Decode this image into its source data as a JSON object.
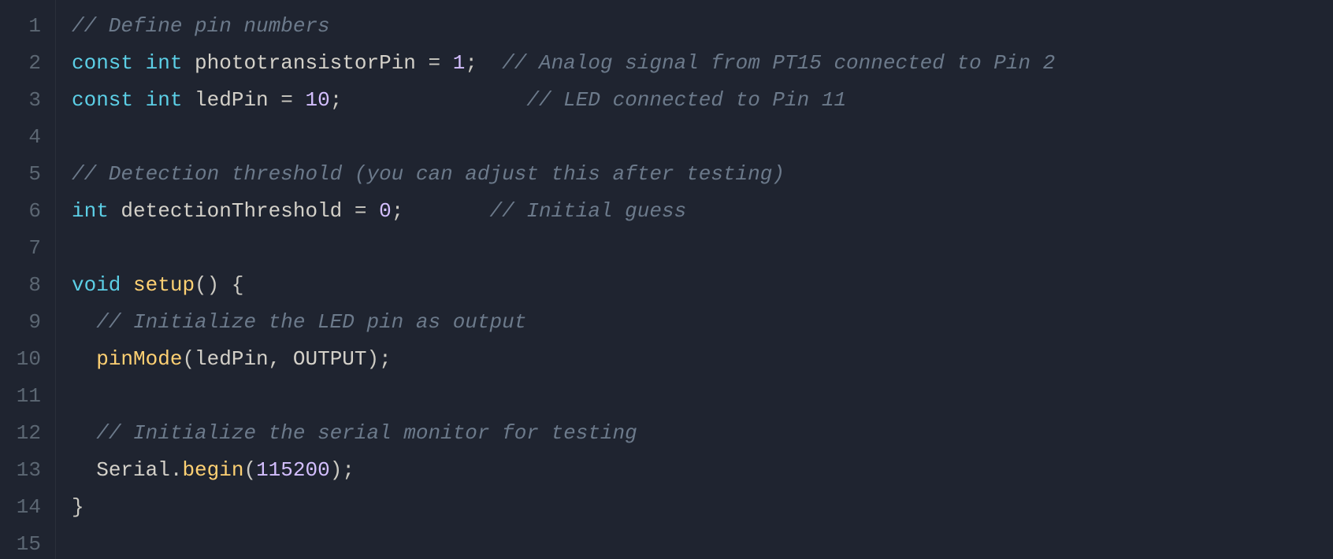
{
  "editor": {
    "lineNumbers": [
      "1",
      "2",
      "3",
      "4",
      "5",
      "6",
      "7",
      "8",
      "9",
      "10",
      "11",
      "12",
      "13",
      "14",
      "15"
    ],
    "code": {
      "l1": {
        "c1": "// Define pin numbers"
      },
      "l2": {
        "kw1": "const",
        "sp1": " ",
        "kw2": "int",
        "sp2": " ",
        "id": "phototransistorPin",
        "sp3": " ",
        "op": "=",
        "sp4": " ",
        "num": "1",
        "semi": ";",
        "pad": "  ",
        "c": "// Analog signal from PT15 connected to Pin 2"
      },
      "l3": {
        "kw1": "const",
        "sp1": " ",
        "kw2": "int",
        "sp2": " ",
        "id": "ledPin",
        "sp3": " ",
        "op": "=",
        "sp4": " ",
        "num": "10",
        "semi": ";",
        "pad": "               ",
        "c": "// LED connected to Pin 11"
      },
      "l4": {
        "blank": ""
      },
      "l5": {
        "c1": "// Detection threshold (you can adjust this after testing)"
      },
      "l6": {
        "kw": "int",
        "sp1": " ",
        "id": "detectionThreshold",
        "sp2": " ",
        "op": "=",
        "sp3": " ",
        "num": "0",
        "semi": ";",
        "pad": "       ",
        "c": "// Initial guess"
      },
      "l7": {
        "blank": ""
      },
      "l8": {
        "kw": "void",
        "sp": " ",
        "fn": "setup",
        "paren": "()",
        "sp2": " ",
        "brace": "{"
      },
      "l9": {
        "indent": "  ",
        "c": "// Initialize the LED pin as output"
      },
      "l10": {
        "indent": "  ",
        "fn": "pinMode",
        "open": "(",
        "arg1": "ledPin",
        "comma": ", ",
        "arg2": "OUTPUT",
        "close": ")",
        "semi": ";"
      },
      "l11": {
        "indent": "  ",
        "blank": ""
      },
      "l12": {
        "indent": "  ",
        "c": "// Initialize the serial monitor for testing"
      },
      "l13": {
        "indent": "  ",
        "obj": "Serial",
        "dot": ".",
        "fn": "begin",
        "open": "(",
        "num": "115200",
        "close": ")",
        "semi": ";"
      },
      "l14": {
        "brace": "}"
      },
      "l15": {
        "blank": ""
      }
    }
  }
}
